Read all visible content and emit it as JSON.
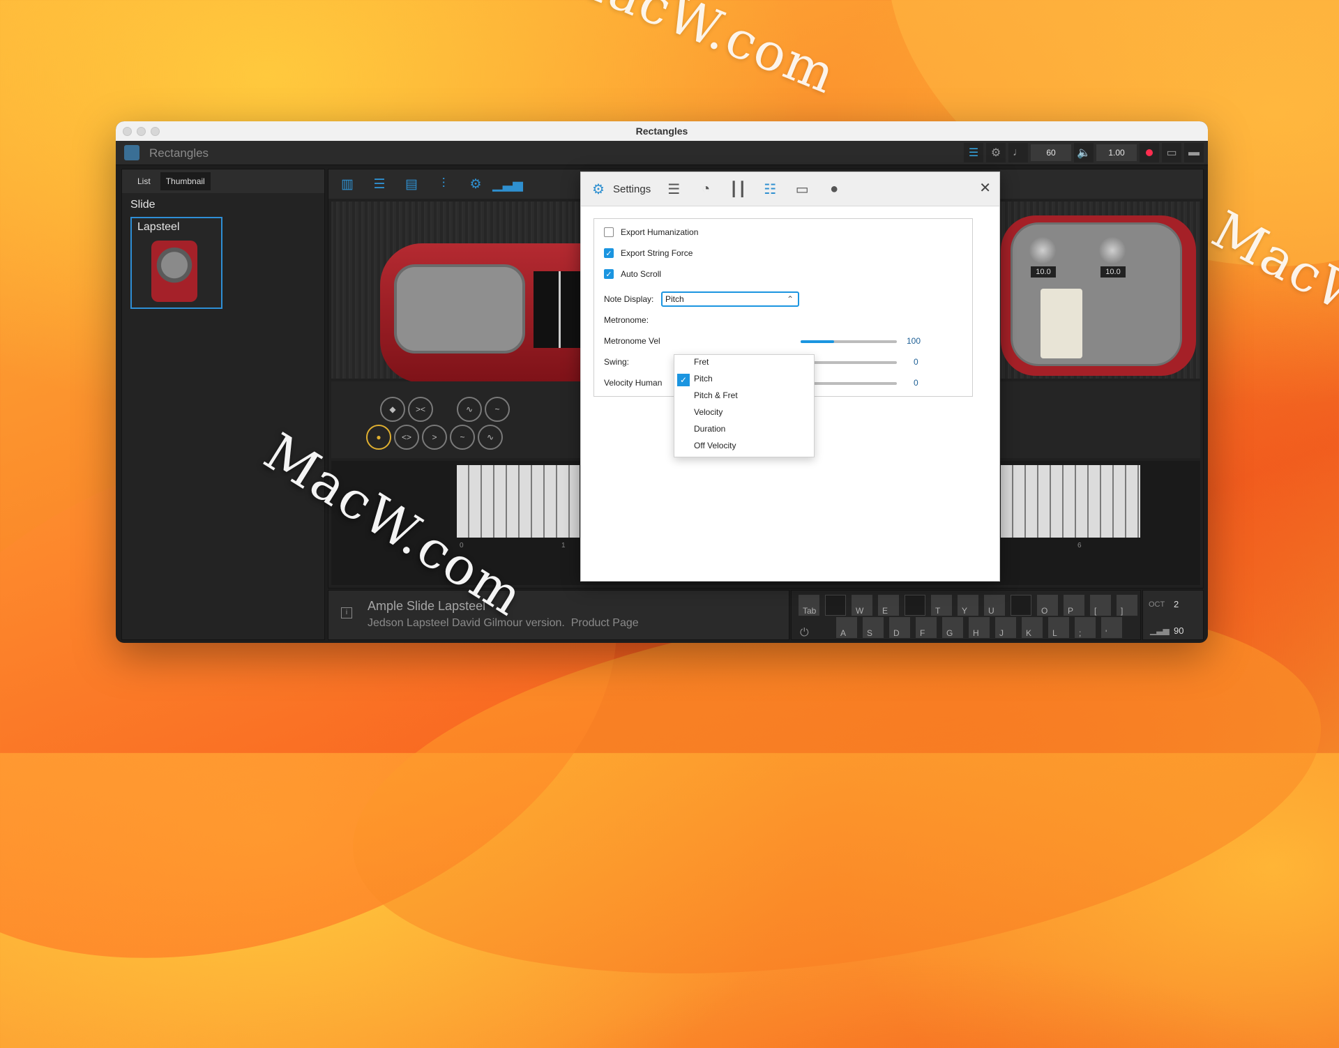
{
  "window": {
    "title": "Rectangles"
  },
  "app": {
    "name": "Rectangles",
    "toolbar": {
      "tempo": "60",
      "volume": "1.00"
    }
  },
  "sidebar": {
    "tabs": [
      "List",
      "Thumbnail"
    ],
    "active_tab": "Thumbnail",
    "heading": "Slide",
    "item_label": "Lapsteel"
  },
  "instrument": {
    "knob_left": "10.0",
    "knob_right": "10.0",
    "name": "Ample Slide Lapsteel",
    "description": "Jedson Lapsteel David Gilmour version.",
    "link": "Product Page",
    "key_labels": [
      "0",
      "1",
      "6"
    ]
  },
  "keymap": {
    "top_row": [
      "Tab",
      "",
      "W",
      "E",
      "",
      "T",
      "Y",
      "U",
      "",
      "O",
      "P",
      "[",
      "]"
    ],
    "bottom_row": [
      "A",
      "S",
      "D",
      "F",
      "G",
      "H",
      "J",
      "K",
      "L",
      ";",
      "'"
    ],
    "oct_label": "OCT",
    "oct_value": "2",
    "velocity_value": "90"
  },
  "settings": {
    "title": "Settings",
    "export_humanization": "Export Humanization",
    "export_string_force": "Export String Force",
    "auto_scroll": "Auto Scroll",
    "note_display_label": "Note Display:",
    "note_display_value": "Pitch",
    "metronome_label": "Metronome:",
    "metronome_vel_label": "Metronome Vel",
    "metronome_vel_value": "100",
    "swing_label": "Swing:",
    "swing_value": "0",
    "velocity_human_label": "Velocity Human",
    "velocity_human_value": "0",
    "metronome_vel_level": 0.35,
    "options": [
      "Fret",
      "Pitch",
      "Pitch & Fret",
      "Velocity",
      "Duration",
      "Off Velocity"
    ],
    "selected_option": "Pitch"
  },
  "watermark": "MacW.com",
  "colors": {
    "accent": "#1b95e0",
    "record": "#ff2d4f"
  }
}
